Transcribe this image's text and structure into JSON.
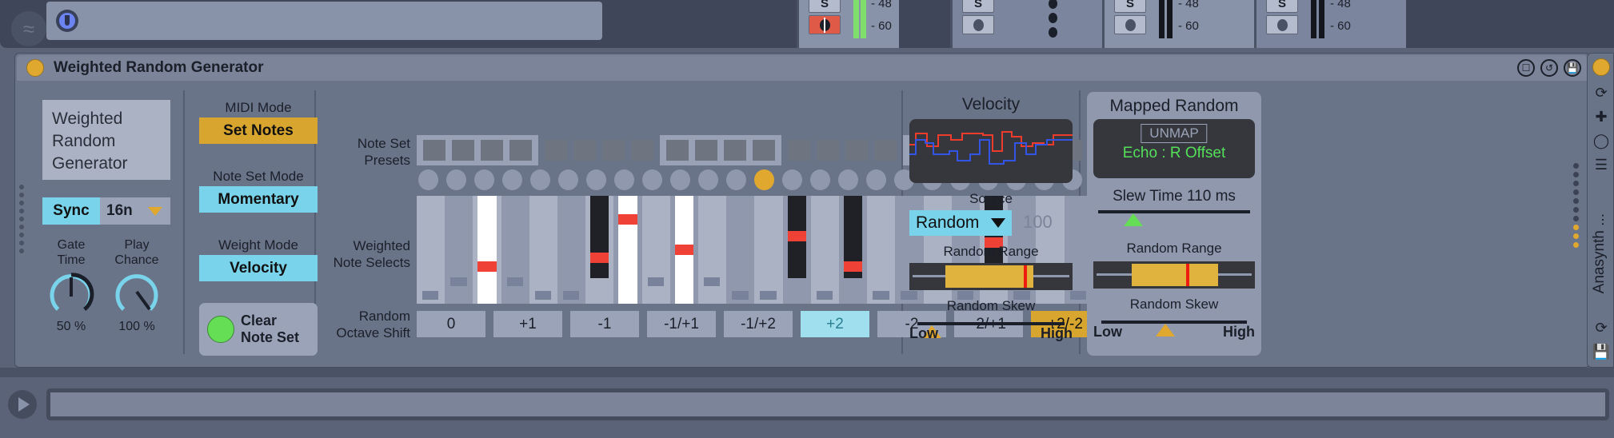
{
  "top_mixer": {
    "tracks": [
      {
        "solo": "S",
        "rec_armed": true,
        "meter_on": true,
        "scale": [
          "- 48",
          "- 60"
        ],
        "dots": false
      },
      {
        "solo": "S",
        "rec_armed": false,
        "meter_on": false,
        "scale": [],
        "dots": true
      },
      {
        "solo": "S",
        "rec_armed": false,
        "meter_on": false,
        "scale": [
          "- 48",
          "- 60"
        ],
        "dots": false
      },
      {
        "solo": "S",
        "rec_armed": false,
        "meter_on": false,
        "scale": [
          "- 48",
          "- 60"
        ],
        "dots": false
      }
    ],
    "m4l_icon": "max-for-live-icon",
    "wave_icon": "waveform-icon"
  },
  "device": {
    "title": "Weighted Random Generator",
    "led_color": "#e0a82e",
    "title_icons": [
      "map-view-icon",
      "reload-icon",
      "save-icon"
    ],
    "info_text": "Weighted Random Generator",
    "sync": {
      "button": "Sync",
      "value": "16n",
      "enabled": true
    },
    "knobs": [
      {
        "label_line1": "Gate",
        "label_line2": "Time",
        "value": "50 %",
        "percent": 50
      },
      {
        "label_line1": "Play",
        "label_line2": "Chance",
        "value": "100 %",
        "percent": 100
      }
    ],
    "modes": [
      {
        "label": "MIDI Mode",
        "value": "Set Notes",
        "style": "amber"
      },
      {
        "label": "Note Set Mode",
        "value": "Momentary",
        "style": "cyan"
      },
      {
        "label": "Weight Mode",
        "value": "Velocity",
        "style": "cyan"
      }
    ],
    "clear": {
      "label_line1": "Clear",
      "label_line2": "Note Set",
      "led_color": "#65dd55"
    },
    "note_set_presets": {
      "label_line1": "Note Set",
      "label_line2": "Presets",
      "count": 24,
      "group_size": 4
    },
    "weighted_note_selects": {
      "label_line1": "Weighted",
      "label_line2": "Note Selects",
      "active_key_dot_index": 12,
      "key_dot_count": 25,
      "handles": [
        {
          "key": 2,
          "type": "white",
          "pos": 0.3
        },
        {
          "key": 6,
          "type": "black",
          "pos": 0.4
        },
        {
          "key": 7,
          "type": "white",
          "pos": 0.84
        },
        {
          "key": 9,
          "type": "white",
          "pos": 0.5
        },
        {
          "key": 13,
          "type": "white",
          "pos": 0.65
        },
        {
          "key": 15,
          "type": "white",
          "pos": 0.3
        },
        {
          "key": 20,
          "type": "black",
          "pos": 0.58
        }
      ]
    },
    "random_octave_shift": {
      "label_line1": "Random",
      "label_line2": "Octave Shift",
      "options": [
        "0",
        "+1",
        "-1",
        "-1/+1",
        "-1/+2",
        "+2",
        "-2",
        "-2/+1",
        "+2/-2"
      ],
      "selected": "+2",
      "amber": "+2/-2"
    },
    "velocity": {
      "title": "Velocity",
      "source_label": "Source",
      "source_value": "Random",
      "source_number": "100",
      "random_range_label": "Random Range",
      "range_fill_start": 0.22,
      "range_fill_end": 0.76,
      "range_marker": 0.72,
      "random_skew_label": "Random Skew",
      "skew_low": "Low",
      "skew_high": "High",
      "skew_pos": 0.08,
      "scope_colors": {
        "line_a": "#ef3b2c",
        "line_b": "#3255e8"
      }
    },
    "mapped_random": {
      "title": "Mapped Random",
      "unmap_label": "UNMAP",
      "mapping_name": "Echo : R Offset",
      "mapping_color": "#55e05a",
      "slew_label": "Slew Time 110 ms",
      "slew_pos": 0.28,
      "random_range_label": "Random Range",
      "range_fill_start": 0.25,
      "range_fill_end": 0.78,
      "range_marker": 0.65,
      "random_skew_label": "Random Skew",
      "skew_low": "Low",
      "skew_high": "High",
      "skew_pos": 0.46
    }
  },
  "collapsed_device": {
    "name": "Anasynth ...",
    "led_color": "#e0a82e",
    "icons": [
      "reload-icon",
      "add-icon",
      "pin-icon",
      "list-icon"
    ],
    "bottom_icons": [
      "reload-icon",
      "save-icon"
    ]
  },
  "bottom_bar": {
    "play_icon": "play-icon"
  }
}
